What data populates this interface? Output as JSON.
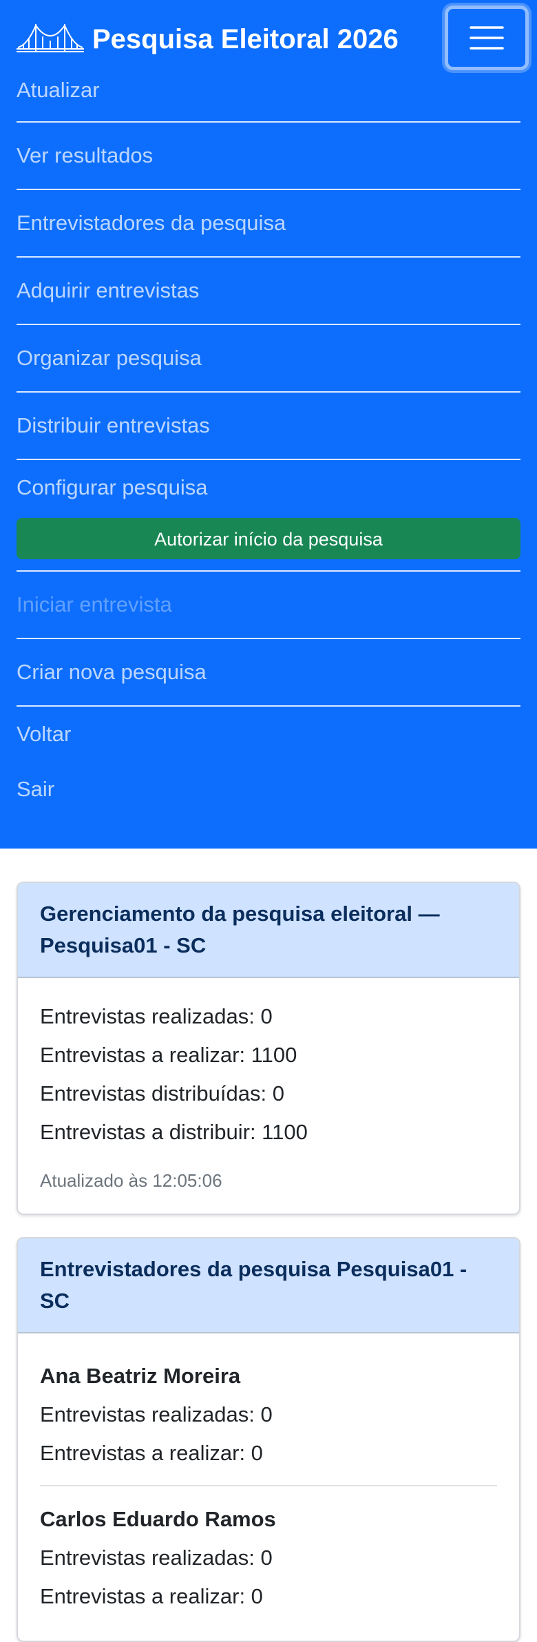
{
  "navbar": {
    "brand_title": "Pesquisa Eleitoral 2026",
    "logo_icon": "bridge-logo-icon",
    "toggler_icon": "hamburger-menu-icon",
    "colors": {
      "background": "#0d6efd",
      "button": "#198754"
    },
    "items": [
      {
        "label": "Atualizar"
      },
      {
        "label": "Ver resultados"
      },
      {
        "label": "Entrevistadores da pesquisa"
      },
      {
        "label": "Adquirir entrevistas"
      },
      {
        "label": "Organizar pesquisa"
      },
      {
        "label": "Distribuir entrevistas"
      },
      {
        "label": "Configurar pesquisa"
      },
      {
        "label": "Iniciar entrevista"
      },
      {
        "label": "Criar nova pesquisa"
      },
      {
        "label": "Voltar"
      },
      {
        "label": "Sair"
      }
    ],
    "authorize_button": "Autorizar início da pesquisa"
  },
  "management_card": {
    "title": "Gerenciamento da pesquisa eleitoral — Pesquisa01 - SC",
    "stats": [
      "Entrevistas realizadas: 0",
      "Entrevistas a realizar: 1100",
      "Entrevistas distribuídas: 0",
      "Entrevistas a distribuir: 1100"
    ],
    "updated": "Atualizado às 12:05:06"
  },
  "interviewers_card": {
    "title": "Entrevistadores da pesquisa Pesquisa01 - SC",
    "interviewers": [
      {
        "name": "Ana Beatriz Moreira",
        "done": "Entrevistas realizadas: 0",
        "todo": "Entrevistas a realizar: 0"
      },
      {
        "name": "Carlos Eduardo Ramos",
        "done": "Entrevistas realizadas: 0",
        "todo": "Entrevistas a realizar: 0"
      }
    ]
  }
}
